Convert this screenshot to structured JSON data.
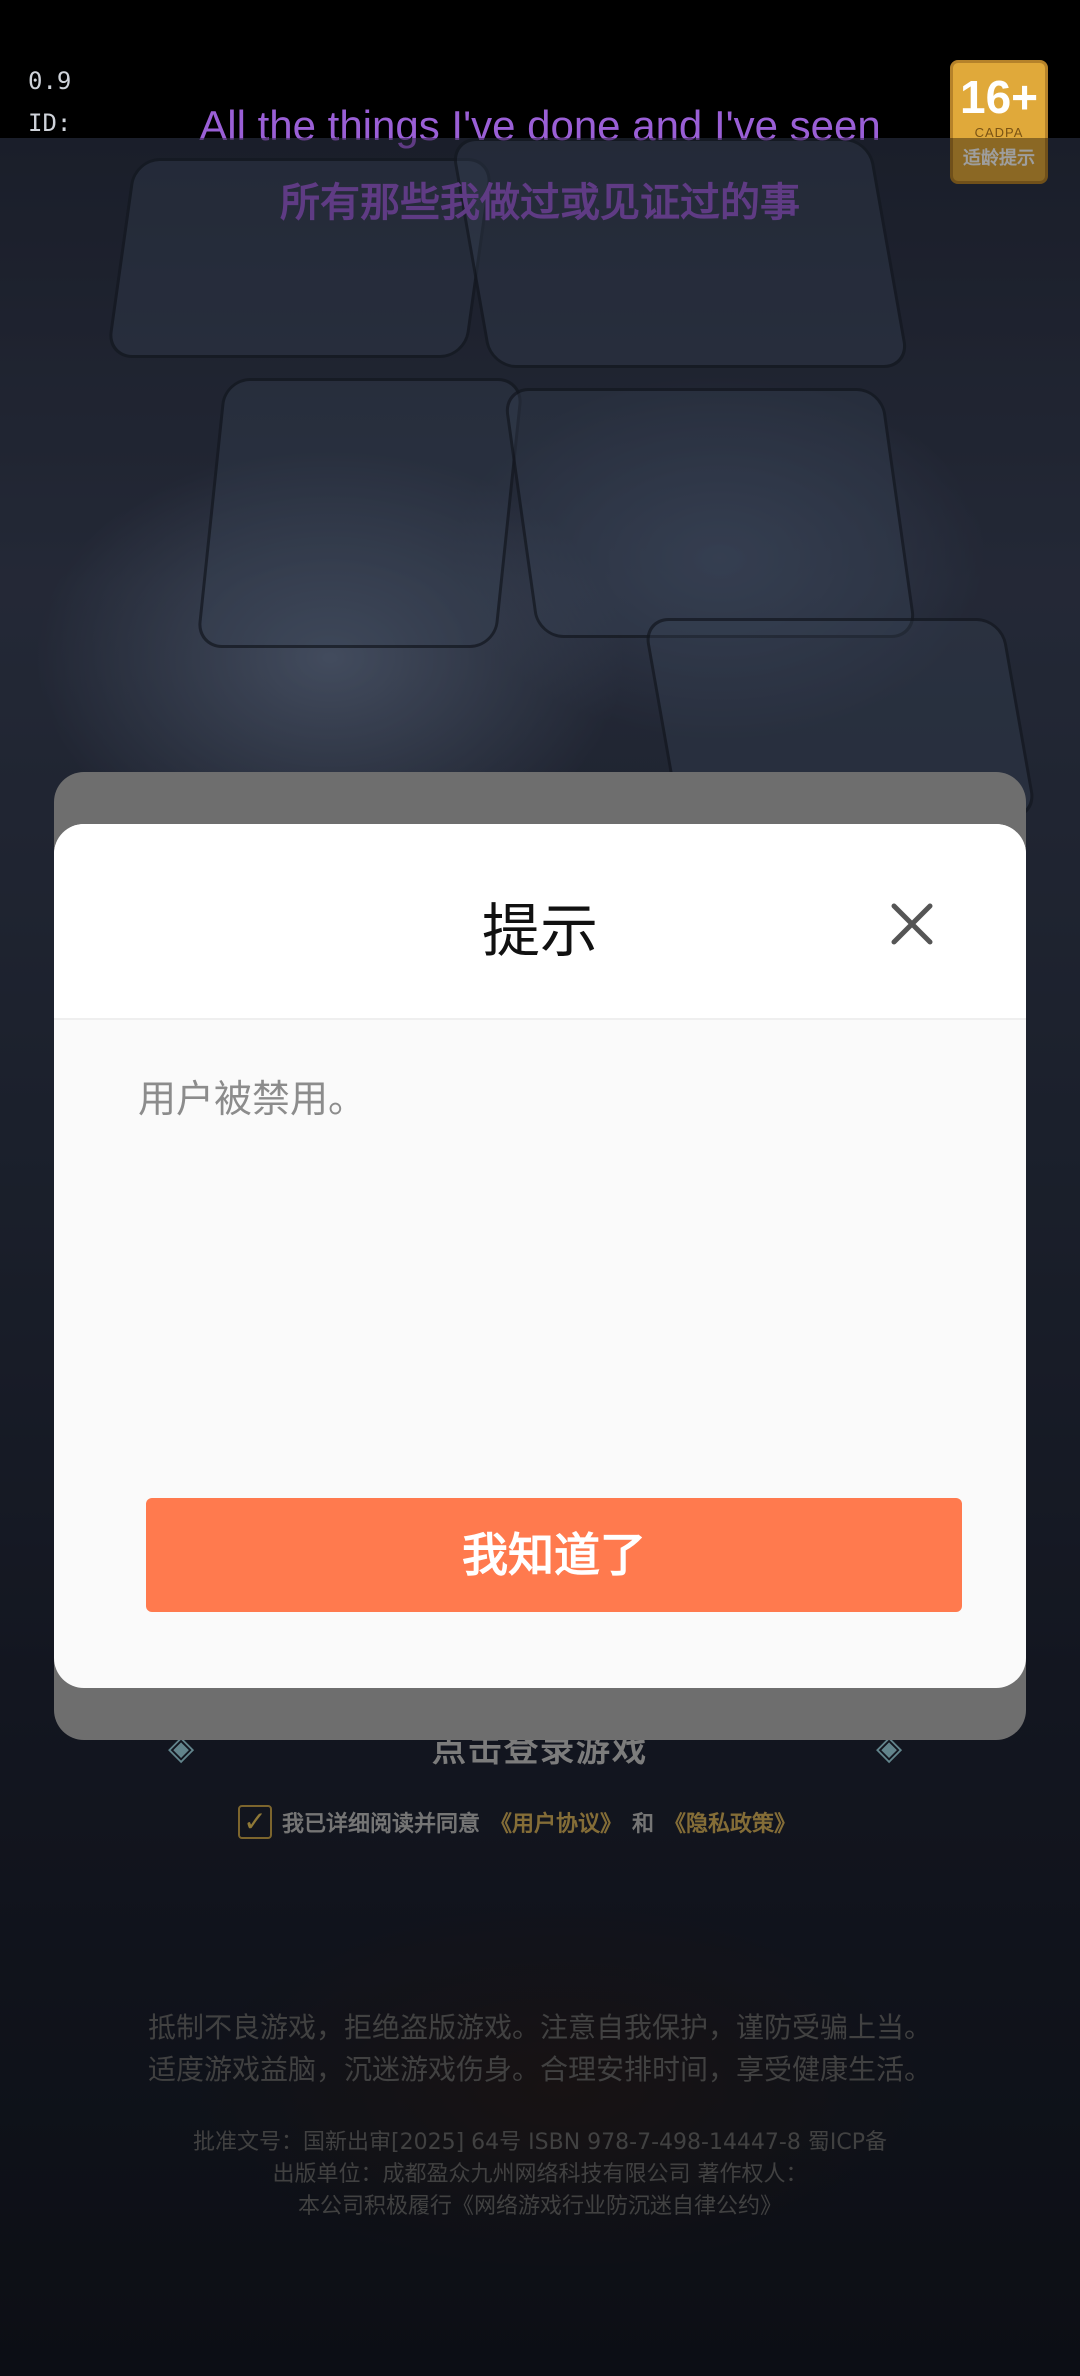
{
  "background": {
    "version_lines": [
      "0.9",
      "ID:"
    ],
    "subtitle_en": "All the things I've done and I've seen",
    "subtitle_cn": "所有那些我做过或见证过的事",
    "age_badge": {
      "age": "16+",
      "org": "CADPA",
      "tip": "适龄提示"
    },
    "login": {
      "label": "点击登录游戏",
      "arrow_left": "◈",
      "arrow_right": "◈"
    },
    "agreement": {
      "text": "我已详细阅读并同意",
      "user_agreement": "《用户协议》",
      "and": "和",
      "privacy_policy": "《隐私政策》"
    },
    "notices": [
      "抵制不良游戏，拒绝盗版游戏。注意自我保护，谨防受骗上当。",
      "适度游戏益脑，沉迷游戏伤身。合理安排时间，享受健康生活。",
      "批准文号：国新出审[2025] 64号 ISBN 978-7-498-14447-8 蜀ICP备",
      "出版单位：成都盈众九州网络科技有限公司 著作权人：",
      "本公司积极履行《网络游戏行业防沉迷自律公约》"
    ]
  },
  "dialog": {
    "title": "提示",
    "message": "用户被禁用。",
    "confirm_label": "我知道了",
    "accent_color": "#ff7a4e"
  }
}
